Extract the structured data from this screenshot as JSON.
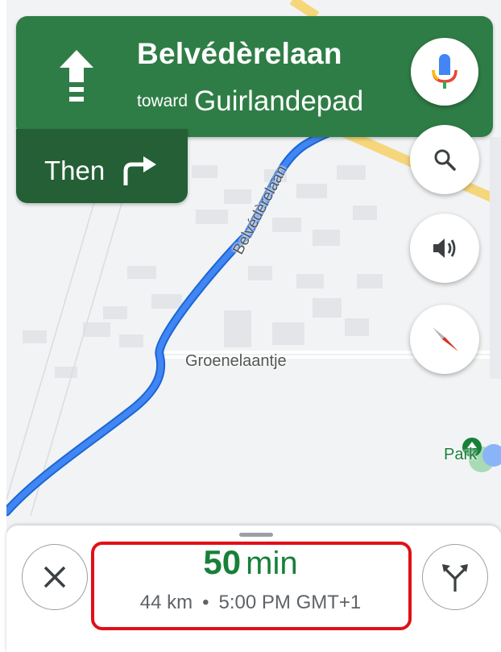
{
  "navigation": {
    "street": "Belvédèrelaan",
    "toward_word": "toward",
    "toward_destination": "Guirlandepad",
    "then_label": "Then",
    "turn_icon": "straight-arrow-icon",
    "then_icon": "turn-right-arrow-icon",
    "card_color": "#2f7d46"
  },
  "map": {
    "labels": {
      "road_main": "Belvédèrelaan",
      "road_cross": "Groenelaantje",
      "park": "Park"
    },
    "route_color": "#4285f4"
  },
  "controls": {
    "mic": "microphone-icon",
    "search": "search-icon",
    "sound": "volume-icon",
    "compass": "compass-icon"
  },
  "trip": {
    "duration_value": "50",
    "duration_unit": "min",
    "distance": "44 km",
    "separator": "•",
    "arrival": "5:00 PM GMT+1",
    "duration_color": "#188038"
  },
  "bottom_bar": {
    "close": "close-icon",
    "alternates": "alternate-routes-icon"
  }
}
